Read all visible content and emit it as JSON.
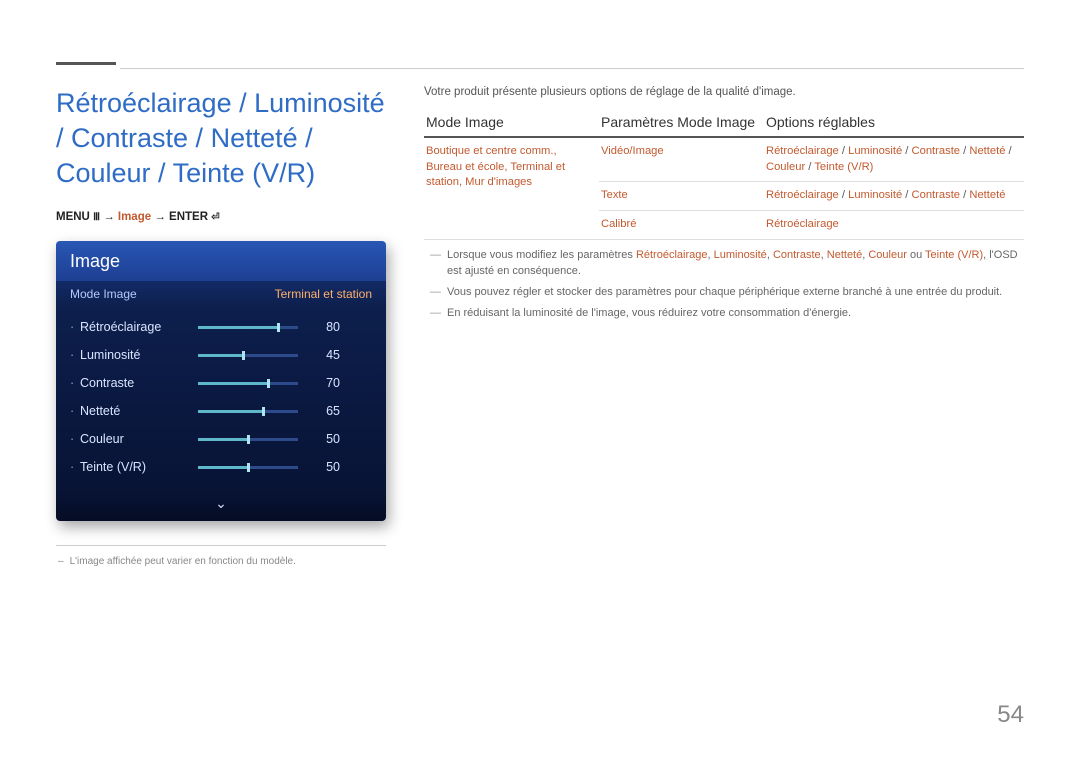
{
  "page_number": "54",
  "heading": "Rétroéclairage / Luminosité / Contraste / Netteté / Couleur / Teinte (V/R)",
  "menu_path": {
    "prefix": "MENU",
    "mid": "Image",
    "suffix": "ENTER"
  },
  "device": {
    "title": "Image",
    "sub_label": "Mode Image",
    "sub_value": "Terminal et station",
    "items": [
      {
        "label": "Rétroéclairage",
        "value": "80",
        "pct": 80
      },
      {
        "label": "Luminosité",
        "value": "45",
        "pct": 45
      },
      {
        "label": "Contraste",
        "value": "70",
        "pct": 70
      },
      {
        "label": "Netteté",
        "value": "65",
        "pct": 65
      },
      {
        "label": "Couleur",
        "value": "50",
        "pct": 50
      },
      {
        "label": "Teinte (V/R)",
        "value": "50",
        "pct": 50
      }
    ]
  },
  "foot_note": "L'image affichée peut varier en fonction du modèle.",
  "intro": "Votre produit présente plusieurs options de réglage de la qualité d'image.",
  "table": {
    "headers": [
      "Mode Image",
      "Paramètres Mode Image",
      "Options réglables"
    ],
    "rows": [
      {
        "c1": "Boutique et centre comm., Bureau et école, Terminal et station, Mur d'images",
        "c2": "Vidéo/Image",
        "c3": [
          "Rétroéclairage",
          " / ",
          "Luminosité",
          " / ",
          "Contraste",
          " / ",
          "Netteté",
          " / ",
          "Couleur",
          " / ",
          "Teinte (V/R)"
        ]
      },
      {
        "c1": "",
        "c2": "Texte",
        "c3": [
          "Rétroéclairage",
          " / ",
          "Luminosité",
          " / ",
          "Contraste",
          " / ",
          "Netteté"
        ]
      },
      {
        "c1": "",
        "c2": "Calibré",
        "c3": [
          "Rétroéclairage"
        ]
      }
    ]
  },
  "notes": [
    {
      "pre": "Lorsque vous modifiez les paramètres ",
      "terms": [
        "Rétroéclairage",
        ", ",
        "Luminosité",
        ", ",
        "Contraste",
        ", ",
        "Netteté",
        ", ",
        "Couleur",
        " ou ",
        "Teinte (V/R)"
      ],
      "post": ", l'OSD est ajusté en conséquence."
    },
    {
      "plain": "Vous pouvez régler et stocker des paramètres pour chaque périphérique externe branché à une entrée du produit."
    },
    {
      "plain": "En réduisant la luminosité de l'image, vous réduirez votre consommation d'énergie."
    }
  ]
}
